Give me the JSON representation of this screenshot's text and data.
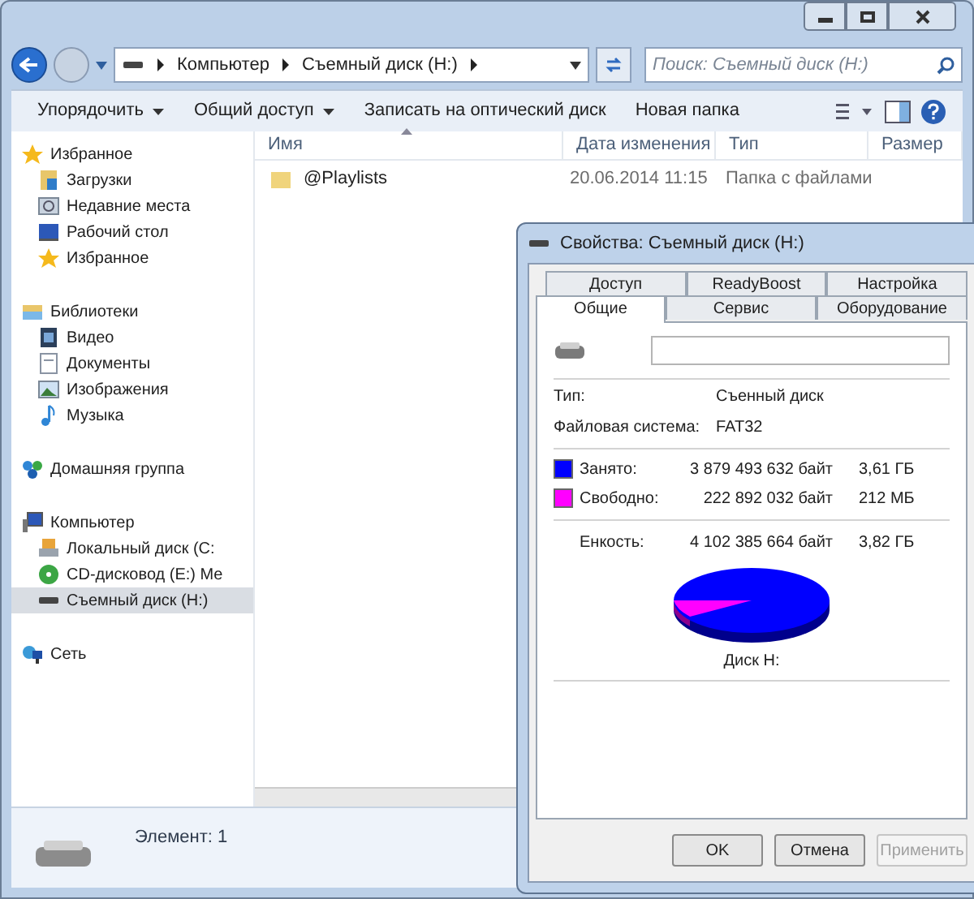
{
  "address_bar": {
    "crumbs": [
      "Компьютер",
      "Съемный диск (H:)"
    ]
  },
  "search": {
    "placeholder": "Поиск: Съемный диск (H:)"
  },
  "toolbar": {
    "items": [
      {
        "label": "Упорядочить",
        "kind": "menu"
      },
      {
        "label": "Общий доступ",
        "kind": "menu"
      },
      {
        "label": "Записать на оптический диск",
        "kind": "button"
      },
      {
        "label": "Новая папка",
        "kind": "button"
      }
    ]
  },
  "sidebar": {
    "groups": [
      {
        "label": "Избранное",
        "selected": false,
        "children": [
          {
            "label": "Загрузки",
            "selected": false
          },
          {
            "label": "Недавние места",
            "selected": false
          },
          {
            "label": "Рабочий стол",
            "selected": false
          },
          {
            "label": "Избранное",
            "selected": false
          }
        ]
      },
      {
        "label": "Библиотеки",
        "selected": false,
        "children": [
          {
            "label": "Видео",
            "selected": false
          },
          {
            "label": "Документы",
            "selected": false
          },
          {
            "label": "Изображения",
            "selected": false
          },
          {
            "label": "Музыка",
            "selected": false
          }
        ]
      },
      {
        "label": "Домашняя группа",
        "selected": false
      },
      {
        "label": "Компьютер",
        "selected": false,
        "children": [
          {
            "label": "Локальный диск (C:",
            "selected": false
          },
          {
            "label": "CD-дисковод (E:) Me",
            "selected": false
          },
          {
            "label": "Съемный диск (H:)",
            "selected": true
          }
        ]
      },
      {
        "label": "Сеть",
        "selected": false
      }
    ]
  },
  "table": {
    "columns": [
      "Имя",
      "Дата изменения",
      "Тип",
      "Размер"
    ],
    "rows": [
      {
        "name": "@Playlists",
        "date": "20.06.2014 11:15",
        "type": "Папка с файлами"
      }
    ]
  },
  "status_bar": {
    "text": "Элемент: 1"
  },
  "dialog": {
    "title": "Свойства: Съемный диск (H:)",
    "tab_rows": [
      [
        {
          "label": "Доступ",
          "selected": false
        },
        {
          "label": "ReadyBoost",
          "selected": false
        },
        {
          "label": "Настройка",
          "selected": false
        }
      ],
      [
        {
          "label": "Общие",
          "selected": true
        },
        {
          "label": "Сервис",
          "selected": false
        },
        {
          "label": "Оборудование",
          "selected": false
        }
      ]
    ],
    "props": [
      {
        "label": "Тип:",
        "value": "Съенный диск"
      },
      {
        "label": "Файловая система:",
        "value": "FAT32"
      }
    ],
    "usage": [
      {
        "label": "Занято:",
        "bytes": "3 879 493 632 байт",
        "size": "3,61 ГБ",
        "color": "#0000ff"
      },
      {
        "label": "Свободно:",
        "bytes": "222 892 032 байт",
        "size": "212 МБ",
        "color": "#ff00ff"
      }
    ],
    "capacity": {
      "label": "Енкость:",
      "bytes": "4 102 385 664 байт",
      "size": "3,82 ГБ"
    },
    "disk_label": "Диск H:",
    "buttons": [
      {
        "label": "OK",
        "disabled": false
      },
      {
        "label": "Отмена",
        "disabled": false
      },
      {
        "label": "Применить",
        "disabled": true
      }
    ]
  }
}
